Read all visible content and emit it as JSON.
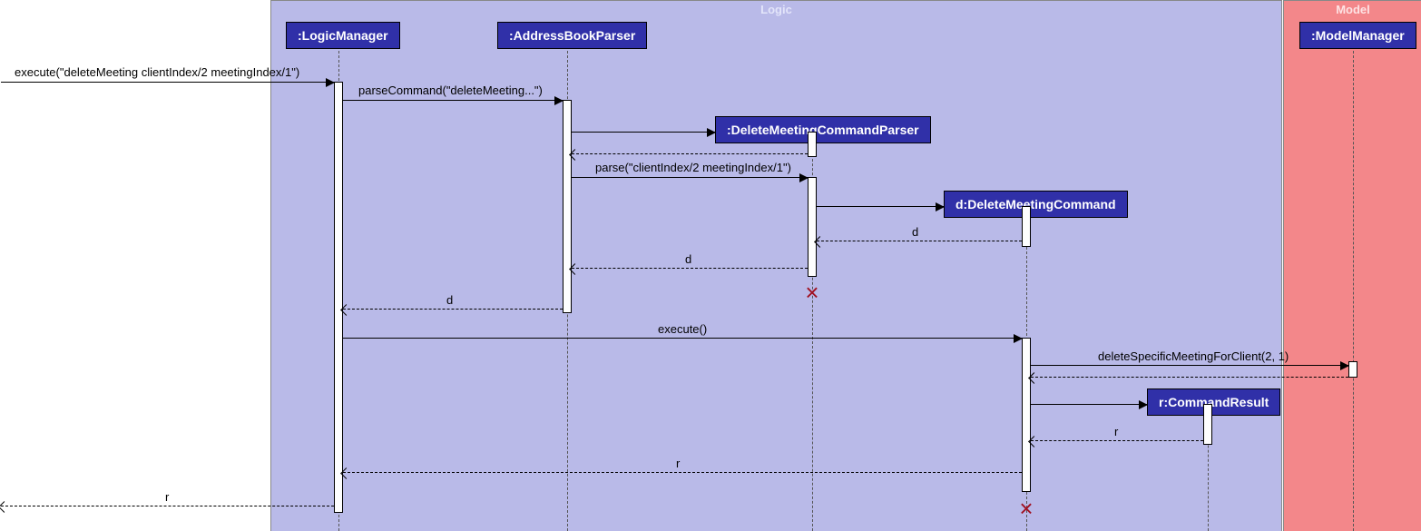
{
  "boxes": {
    "logic_label": "Logic",
    "model_label": "Model"
  },
  "participants": {
    "logic_manager": ":LogicManager",
    "address_book_parser": ":AddressBookParser",
    "delete_meeting_parser": ":DeleteMeetingCommandParser",
    "delete_meeting_command": "d:DeleteMeetingCommand",
    "command_result": "r:CommandResult",
    "model_manager": ":ModelManager"
  },
  "messages": {
    "execute_entry": "execute(\"deleteMeeting clientIndex/2 meetingIndex/1\")",
    "parse_command": "parseCommand(\"deleteMeeting...\")",
    "parse_args": "parse(\"clientIndex/2 meetingIndex/1\")",
    "return_d1": "d",
    "return_d2": "d",
    "return_d3": "d",
    "execute_call": "execute()",
    "delete_specific": "deleteSpecificMeetingForClient(2, 1)",
    "return_r1": "r",
    "return_r2": "r",
    "return_r3": "r"
  }
}
